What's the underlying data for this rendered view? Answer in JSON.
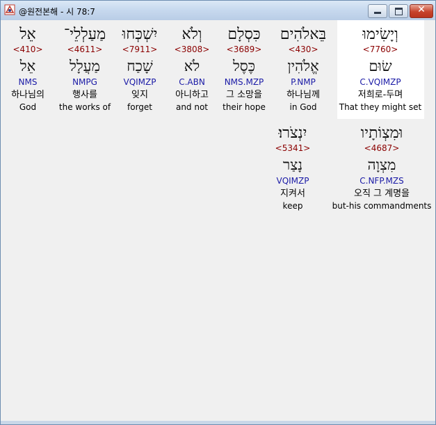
{
  "window": {
    "title": "@원전본해 - 시 78:7",
    "controls": {
      "minimize": "minimize",
      "maximize": "maximize",
      "close": "✕"
    }
  },
  "verse_rows": [
    {
      "words": [
        {
          "hebrew": "וְיָשִׂימוּ",
          "strong": "<7760>",
          "lemma": "שׂוּם",
          "morph": "C.VQIMZP",
          "korean": "저희로-두며",
          "english": "That they might set",
          "selected": true
        },
        {
          "hebrew": "בֵּאלֹהִים",
          "strong": "<430>",
          "lemma": "אֱלֹהִין",
          "morph": "P.NMP",
          "korean": "하나님께",
          "english": "in God"
        },
        {
          "hebrew": "כִּסְלָם",
          "strong": "<3689>",
          "lemma": "כֶּסֶל",
          "morph": "NMS.MZP",
          "korean": "그 소망을",
          "english": "their hope"
        },
        {
          "hebrew": "וְלֹא",
          "strong": "<3808>",
          "lemma": "לֹא",
          "morph": "C.ABN",
          "korean": "아니하고",
          "english": "and not"
        },
        {
          "hebrew": "יִשְׁכְּחוּ",
          "strong": "<7911>",
          "lemma": "שָׁכַח",
          "morph": "VQIMZP",
          "korean": "잊지",
          "english": "forget"
        },
        {
          "hebrew": "מַעַלְלֵי־",
          "strong": "<4611>",
          "lemma": "מַעֲלָל",
          "morph": "NMPG",
          "korean": "행사를",
          "english": "the works of"
        },
        {
          "hebrew": "אֵל",
          "strong": "<410>",
          "lemma": "אֵל",
          "morph": "NMS",
          "korean": "하나님의",
          "english": "God"
        }
      ]
    },
    {
      "words": [
        {
          "hebrew": "וּמִצְוֹתָיו",
          "strong": "<4687>",
          "lemma": "מִצְוָה",
          "morph": "C.NFP.MZS",
          "korean": "오직 그 계명을",
          "english": "but-his commandments"
        },
        {
          "hebrew": "יִנְצֹרוּ׃",
          "strong": "<5341>",
          "lemma": "נָצַר",
          "morph": "VQIMZP",
          "korean": "지켜서",
          "english": "keep"
        }
      ]
    }
  ]
}
